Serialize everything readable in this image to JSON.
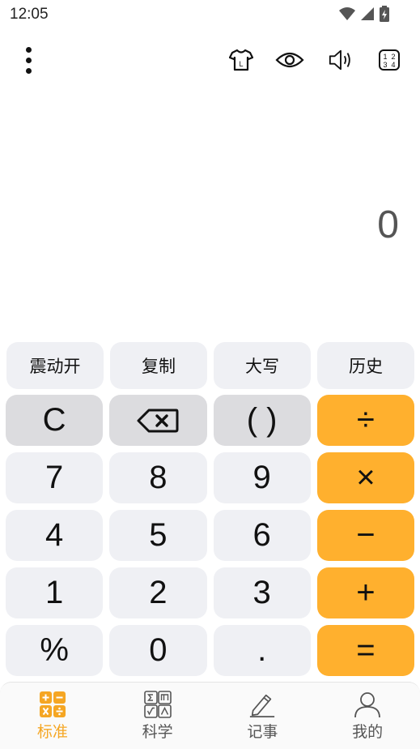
{
  "status_bar": {
    "time": "12:05"
  },
  "toolbar": {
    "icons": [
      "more-vert-icon",
      "shirt-icon",
      "eye-icon",
      "volume-icon",
      "keypad-layout-icon"
    ]
  },
  "display": {
    "value": "0"
  },
  "function_row": [
    {
      "label": "震动开"
    },
    {
      "label": "复制"
    },
    {
      "label": "大写"
    },
    {
      "label": "历史"
    }
  ],
  "keypad": {
    "rows": [
      [
        {
          "label": "C",
          "style": "gray"
        },
        {
          "label": "⌫",
          "style": "gray",
          "icon": "backspace-icon"
        },
        {
          "label": "( )",
          "style": "gray"
        },
        {
          "label": "÷",
          "style": "orange"
        }
      ],
      [
        {
          "label": "7",
          "style": "light"
        },
        {
          "label": "8",
          "style": "light"
        },
        {
          "label": "9",
          "style": "light"
        },
        {
          "label": "×",
          "style": "orange"
        }
      ],
      [
        {
          "label": "4",
          "style": "light"
        },
        {
          "label": "5",
          "style": "light"
        },
        {
          "label": "6",
          "style": "light"
        },
        {
          "label": "−",
          "style": "orange"
        }
      ],
      [
        {
          "label": "1",
          "style": "light"
        },
        {
          "label": "2",
          "style": "light"
        },
        {
          "label": "3",
          "style": "light"
        },
        {
          "label": "+",
          "style": "orange"
        }
      ],
      [
        {
          "label": "%",
          "style": "light"
        },
        {
          "label": "0",
          "style": "light"
        },
        {
          "label": ".",
          "style": "light"
        },
        {
          "label": "=",
          "style": "orange"
        }
      ]
    ]
  },
  "bottom_nav": {
    "items": [
      {
        "label": "标准",
        "icon": "standard-calc-icon",
        "active": true
      },
      {
        "label": "科学",
        "icon": "scientific-calc-icon",
        "active": false
      },
      {
        "label": "记事",
        "icon": "notes-pencil-icon",
        "active": false
      },
      {
        "label": "我的",
        "icon": "profile-icon",
        "active": false
      }
    ]
  },
  "colors": {
    "accent": "#ffb02e",
    "key_light": "#eff0f4",
    "key_gray": "#dcdcdf",
    "nav_active": "#f5a623"
  }
}
